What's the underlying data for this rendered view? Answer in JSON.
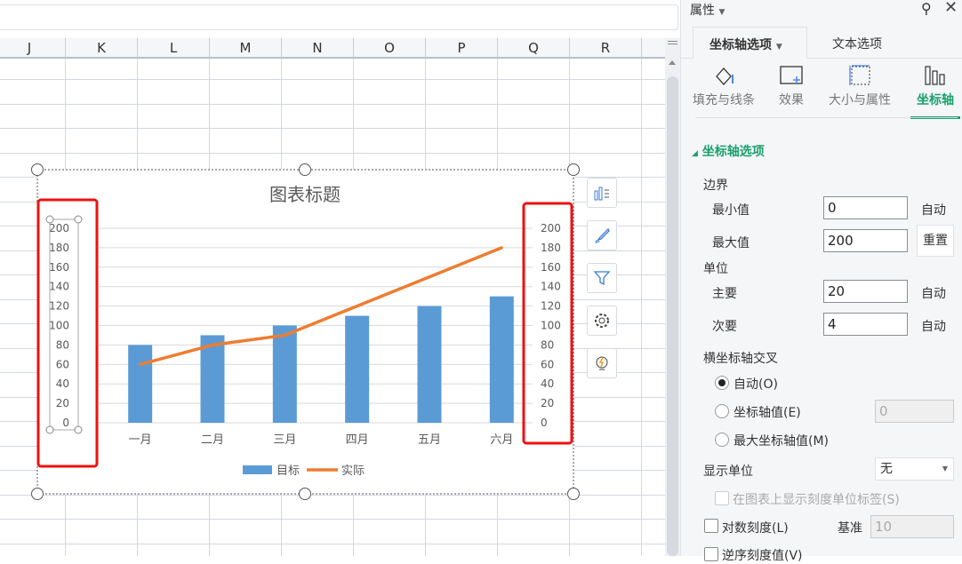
{
  "sheet": {
    "columns": [
      "J",
      "K",
      "L",
      "M",
      "N",
      "O",
      "P",
      "Q",
      "R"
    ]
  },
  "chart_data": {
    "type": "bar",
    "title": "图表标题",
    "categories": [
      "一月",
      "二月",
      "三月",
      "四月",
      "五月",
      "六月"
    ],
    "series": [
      {
        "name": "目标",
        "type": "bar",
        "color": "#5b9bd5",
        "values": [
          80,
          90,
          100,
          110,
          120,
          130
        ]
      },
      {
        "name": "实际",
        "type": "line",
        "color": "#ed7d31",
        "values": [
          60,
          80,
          90,
          120,
          150,
          180
        ]
      }
    ],
    "ylim": [
      0,
      200
    ],
    "yticks": [
      "0",
      "20",
      "40",
      "60",
      "80",
      "100",
      "120",
      "140",
      "160",
      "180",
      "200"
    ],
    "y2ticks": [
      "0",
      "20",
      "40",
      "60",
      "80",
      "100",
      "120",
      "140",
      "160",
      "180",
      "200"
    ],
    "grid": true,
    "legend": "bottom"
  },
  "panel": {
    "title": "属性",
    "tabs": [
      "坐标轴选项",
      "文本选项"
    ],
    "subtabs": [
      "填充与线条",
      "效果",
      "大小与属性",
      "坐标轴"
    ],
    "section": "坐标轴选项",
    "bounds_label": "边界",
    "min_label": "最小值",
    "min_value": "0",
    "min_auto": "自动",
    "max_label": "最大值",
    "max_value": "200",
    "max_reset": "重置",
    "unit_label": "单位",
    "major_label": "主要",
    "major_value": "20",
    "major_auto": "自动",
    "minor_label": "次要",
    "minor_value": "4",
    "minor_auto": "自动",
    "cross_label": "横坐标轴交叉",
    "cross_auto": "自动(O)",
    "cross_value_label": "坐标轴值(E)",
    "cross_value": "0",
    "cross_max": "最大坐标轴值(M)",
    "display_unit_label": "显示单位",
    "display_unit_value": "无",
    "show_unit_label": "在图表上显示刻度单位标签(S)",
    "log_label": "对数刻度(L)",
    "base_label": "基准",
    "base_value": "10",
    "reverse_label": "逆序刻度值(V)"
  }
}
